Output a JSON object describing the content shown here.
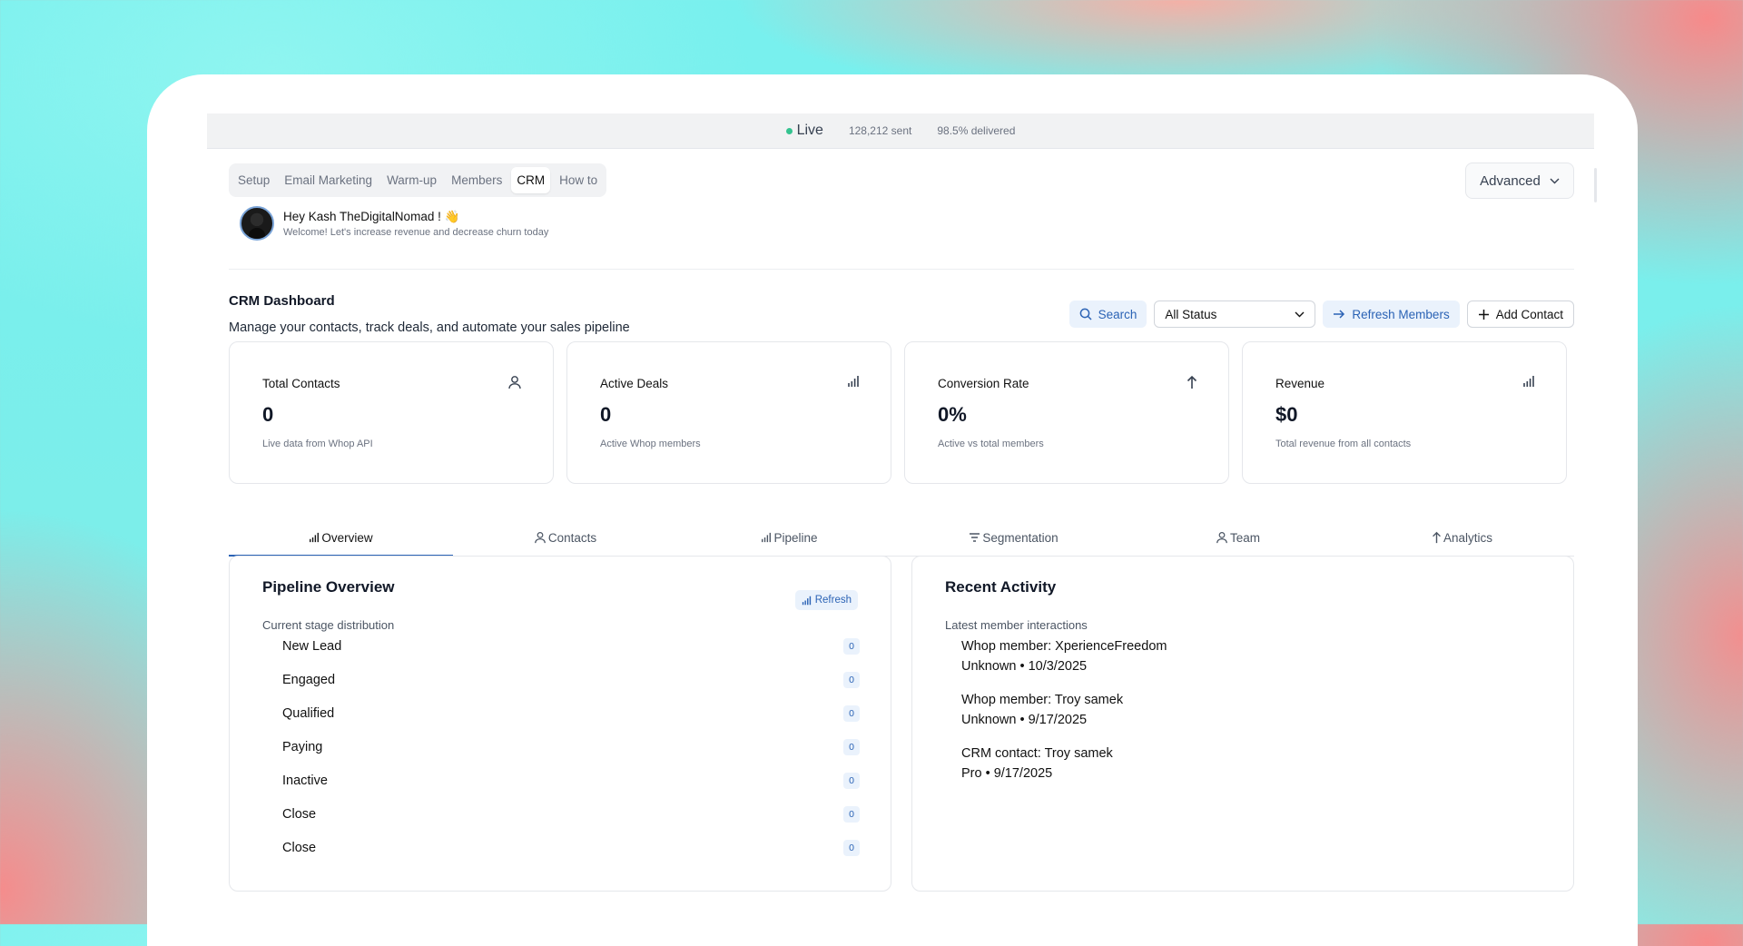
{
  "status": {
    "live_label": "Live",
    "sent": "128,212 sent",
    "delivered": "98.5% delivered"
  },
  "topnav": {
    "tabs": [
      "Setup",
      "Email Marketing",
      "Warm-up",
      "Members",
      "CRM",
      "How to"
    ],
    "active": "CRM"
  },
  "advanced": {
    "label": "Advanced"
  },
  "greeting": {
    "title": "Hey Kash TheDigitalNomad ! 👋",
    "subtitle": "Welcome! Let's increase revenue and decrease churn today"
  },
  "dashboard": {
    "title": "CRM Dashboard",
    "subtitle": "Manage your contacts, track deals, and automate your sales pipeline",
    "search_label": "Search",
    "status_filter": "All Status",
    "refresh_members_label": "Refresh Members",
    "add_contact_label": "Add Contact"
  },
  "stats": [
    {
      "label": "Total Contacts",
      "value": "0",
      "note": "Live data from Whop API",
      "icon": "user-icon"
    },
    {
      "label": "Active Deals",
      "value": "0",
      "note": "Active Whop members",
      "icon": "bar-chart-icon"
    },
    {
      "label": "Conversion Rate",
      "value": "0%",
      "note": "Active vs total members",
      "icon": "arrow-up-icon"
    },
    {
      "label": "Revenue",
      "value": "$0",
      "note": "Total revenue from all contacts",
      "icon": "bar-chart-icon"
    }
  ],
  "tabs": [
    "Overview",
    "Contacts",
    "Pipeline",
    "Segmentation",
    "Team",
    "Analytics"
  ],
  "pipeline": {
    "title": "Pipeline Overview",
    "subtitle": "Current stage distribution",
    "refresh_label": "Refresh",
    "stages": [
      {
        "name": "New Lead",
        "count": "0"
      },
      {
        "name": "Engaged",
        "count": "0"
      },
      {
        "name": "Qualified",
        "count": "0"
      },
      {
        "name": "Paying",
        "count": "0"
      },
      {
        "name": "Inactive",
        "count": "0"
      },
      {
        "name": "Close",
        "count": "0"
      },
      {
        "name": "Close",
        "count": "0"
      }
    ]
  },
  "activity": {
    "title": "Recent Activity",
    "subtitle": "Latest member interactions",
    "items": [
      {
        "title": "Whop member: XperienceFreedom",
        "meta": "Unknown • 10/3/2025"
      },
      {
        "title": "Whop member: Troy samek",
        "meta": "Unknown • 9/17/2025"
      },
      {
        "title": "CRM contact: Troy samek",
        "meta": "Pro • 9/17/2025"
      }
    ]
  },
  "colors": {
    "accent": "#2b63b5",
    "live": "#34c38f",
    "soft_blue": "#eaf2fc"
  }
}
